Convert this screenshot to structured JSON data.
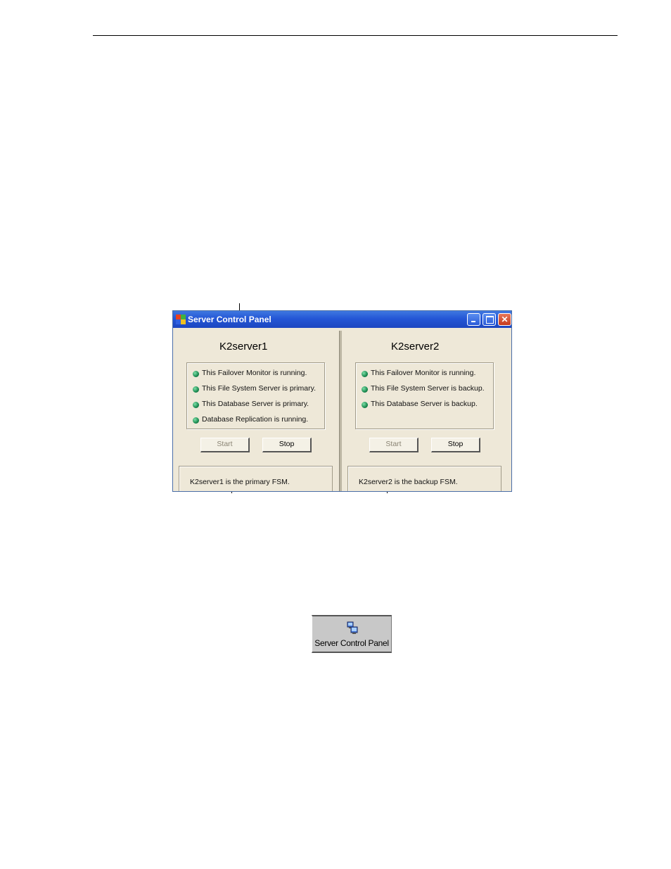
{
  "window": {
    "title": "Server Control Panel",
    "panes": [
      {
        "server_name": "K2server1",
        "status_lines": [
          "This Failover Monitor is running.",
          "This File System Server is primary.",
          "This Database Server is primary.",
          "Database Replication is running."
        ],
        "start_label": "Start",
        "stop_label": "Stop",
        "message": "K2server1 is the primary FSM."
      },
      {
        "server_name": "K2server2",
        "status_lines": [
          "This Failover Monitor is running.",
          "This File System Server is backup.",
          "This Database Server is backup."
        ],
        "start_label": "Start",
        "stop_label": "Stop",
        "message": "K2server2 is the backup FSM."
      }
    ]
  },
  "toolbar_button": {
    "label": "Server Control Panel",
    "icon": "server-control-panel-icon"
  },
  "colors": {
    "title_bar": "#2456d6",
    "window_bg": "#eee8d8",
    "led": "#1a8a50"
  }
}
